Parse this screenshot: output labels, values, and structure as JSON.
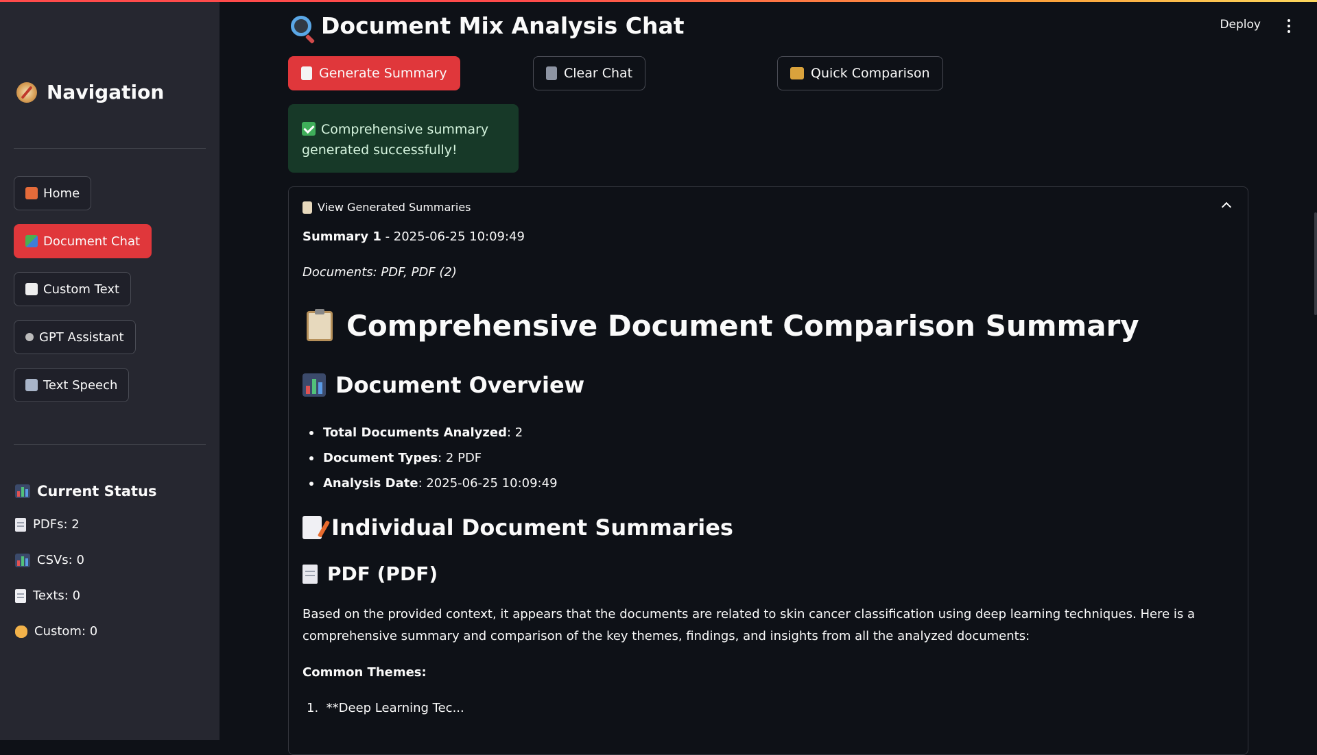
{
  "sidebar": {
    "title": "Navigation",
    "nav": [
      {
        "label": "Home",
        "active": false
      },
      {
        "label": "Document Chat",
        "active": true
      },
      {
        "label": "Custom Text",
        "active": false
      },
      {
        "label": "GPT Assistant",
        "active": false
      },
      {
        "label": "Text Speech",
        "active": false
      }
    ],
    "status_title": "Current Status",
    "status": [
      {
        "label": "PDFs: 2"
      },
      {
        "label": "CSVs: 0"
      },
      {
        "label": "Texts: 0"
      },
      {
        "label": "Custom: 0"
      }
    ]
  },
  "header": {
    "title": "Document Mix Analysis Chat",
    "deploy": "Deploy"
  },
  "toolbar": {
    "generate": "Generate Summary",
    "clear": "Clear Chat",
    "compare": "Quick Comparison"
  },
  "alert": {
    "text": "Comprehensive summary generated successfully!"
  },
  "expander": {
    "label": "View Generated Summaries",
    "summary_label": "Summary 1",
    "summary_time": " - 2025-06-25 10:09:49",
    "documents": "Documents: PDF, PDF (2)",
    "h1": "Comprehensive Document Comparison Summary",
    "overview_title": "Document Overview",
    "overview": [
      {
        "key": "Total Documents Analyzed",
        "value": ": 2"
      },
      {
        "key": "Document Types",
        "value": ": 2 PDF"
      },
      {
        "key": "Analysis Date",
        "value": ": 2025-06-25 10:09:49"
      }
    ],
    "individual_title": "Individual Document Summaries",
    "pdf_title": "PDF (PDF)",
    "paragraph": "Based on the provided context, it appears that the documents are related to skin cancer classification using deep learning techniques. Here is a comprehensive summary and comparison of the key themes, findings, and insights from all the analyzed documents:",
    "common_themes": "Common Themes:",
    "list_number": "1.",
    "list_item": "**Deep Learning Tec..."
  },
  "colors": {
    "accent": "#e0373b",
    "sidebar_bg": "#262730",
    "main_bg": "#0e1117",
    "success_bg": "#173928"
  }
}
